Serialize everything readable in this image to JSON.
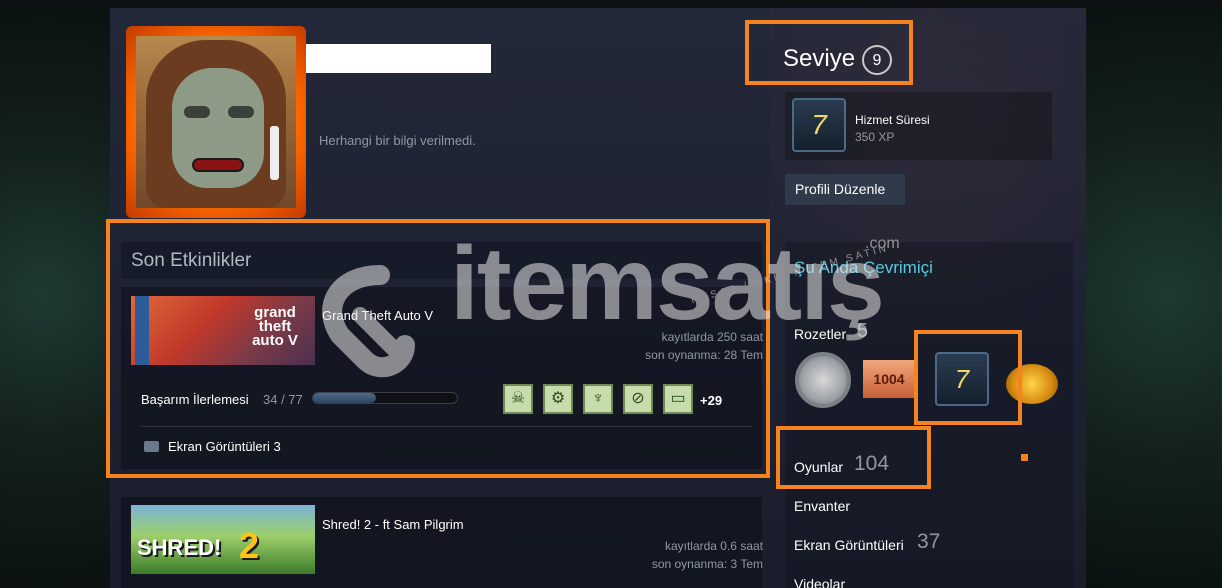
{
  "profile": {
    "summary": "Herhangi bir bilgi verilmedi."
  },
  "level": {
    "label": "Seviye",
    "value": "9"
  },
  "featured_badge": {
    "icon": "7",
    "title": "Hizmet Süresi",
    "xp": "350 XP"
  },
  "edit_profile_label": "Profili Düzenle",
  "status": "Şu Anda Çevrimiçi",
  "badges": {
    "label": "Rozetler",
    "count": "5",
    "items": [
      {
        "name": "silver-badge-icon",
        "text": ""
      },
      {
        "name": "1004-badge-icon",
        "text": "1004"
      },
      {
        "name": "service-years-badge-icon",
        "text": "7"
      },
      {
        "name": "gold-badge-icon",
        "text": ""
      }
    ]
  },
  "games": {
    "label": "Oyunlar",
    "count": "104"
  },
  "inventory_label": "Envanter",
  "screenshots": {
    "label": "Ekran Görüntüleri",
    "count": "37"
  },
  "videos_label": "Videolar",
  "activity": {
    "title": "Son Etkinlikler",
    "games": [
      {
        "name": "Grand Theft Auto V",
        "capsule_text": "grand theft auto V",
        "hours": "kayıtlarda 250 saat",
        "last_played": "son oynanma: 28 Tem",
        "achievement_label": "Başarım İlerlemesi",
        "achievement_count": "34 / 77",
        "achievement_progress": 0.44,
        "achievement_more": "+29",
        "screenshots_label": "Ekran Görüntüleri 3"
      },
      {
        "name": "Shred! 2 - ft Sam Pilgrim",
        "capsule_text": "SHRED!",
        "capsule_num": "2",
        "hours": "kayıtlarda 0.6 saat",
        "last_played": "son oynanma: 3 Tem"
      }
    ]
  },
  "watermark": {
    "text": "itemsatış",
    "com": ".com",
    "sub": "HESAP / SKIN / ITEM SATIN"
  },
  "colors": {
    "highlight": "#f58320",
    "online": "#57cbde"
  }
}
